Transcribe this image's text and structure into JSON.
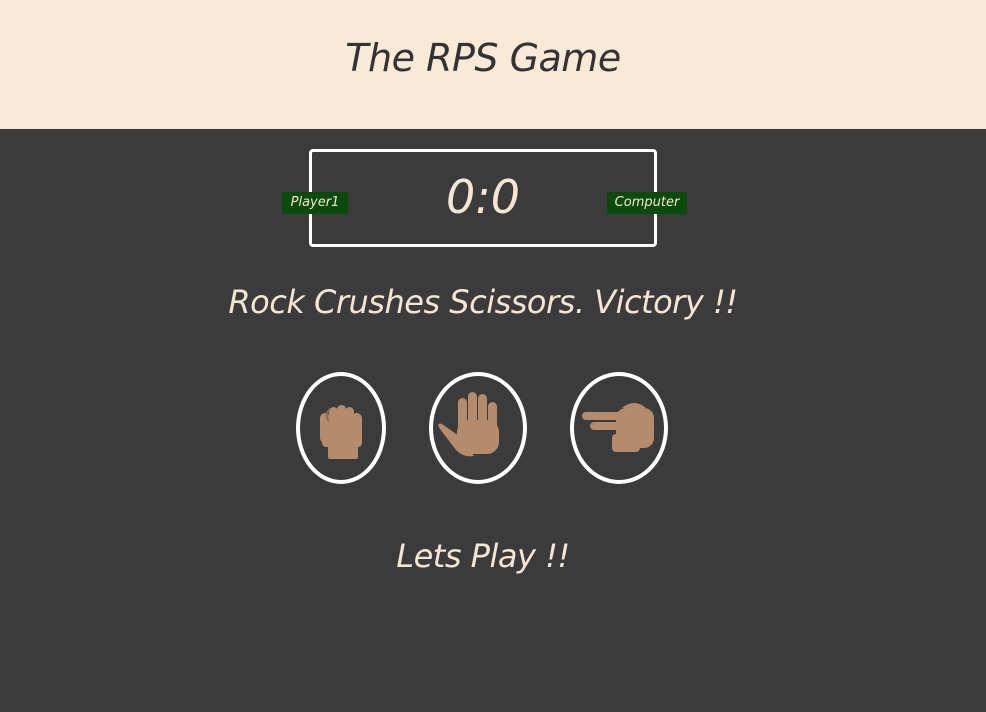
{
  "header": {
    "title": "The RPS Game"
  },
  "scoreboard": {
    "score": "0:0",
    "user_label": "Player1",
    "computer_label": "Computer"
  },
  "result": {
    "message": "Rock Crushes Scissors. Victory !!"
  },
  "choices": [
    {
      "id": "rock",
      "icon": "raised-fist-icon"
    },
    {
      "id": "paper",
      "icon": "raised-hand-icon"
    },
    {
      "id": "scissors",
      "icon": "victory-hand-icon"
    }
  ],
  "action": {
    "message": "Lets Play !!"
  },
  "colors": {
    "header_bg": "#f9ead8",
    "body_bg": "#3b3b3b",
    "text": "#f5e5d3",
    "badge_bg": "#0a4a0a",
    "skin": "#b48c6b",
    "border": "#ffffff"
  }
}
